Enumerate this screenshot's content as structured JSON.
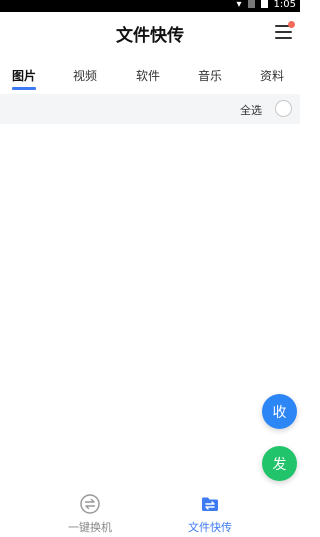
{
  "status_bar": {
    "time": "1:05"
  },
  "header": {
    "title": "文件快传"
  },
  "tabs": [
    {
      "label": "图片",
      "active": true
    },
    {
      "label": "视频",
      "active": false
    },
    {
      "label": "软件",
      "active": false
    },
    {
      "label": "音乐",
      "active": false
    },
    {
      "label": "资料",
      "active": false
    }
  ],
  "select_bar": {
    "select_all_label": "全选"
  },
  "fab": {
    "receive_label": "收",
    "send_label": "发"
  },
  "bottom_nav": [
    {
      "label": "一键换机",
      "icon": "switch-phone-icon",
      "active": false
    },
    {
      "label": "文件快传",
      "icon": "folder-transfer-icon",
      "active": true
    }
  ],
  "colors": {
    "accent": "#3d7bf2",
    "receive_fab": "#2c86f6",
    "send_fab": "#21c46a",
    "notification_dot": "#f26a5a",
    "select_bar_bg": "#f4f5f7"
  }
}
